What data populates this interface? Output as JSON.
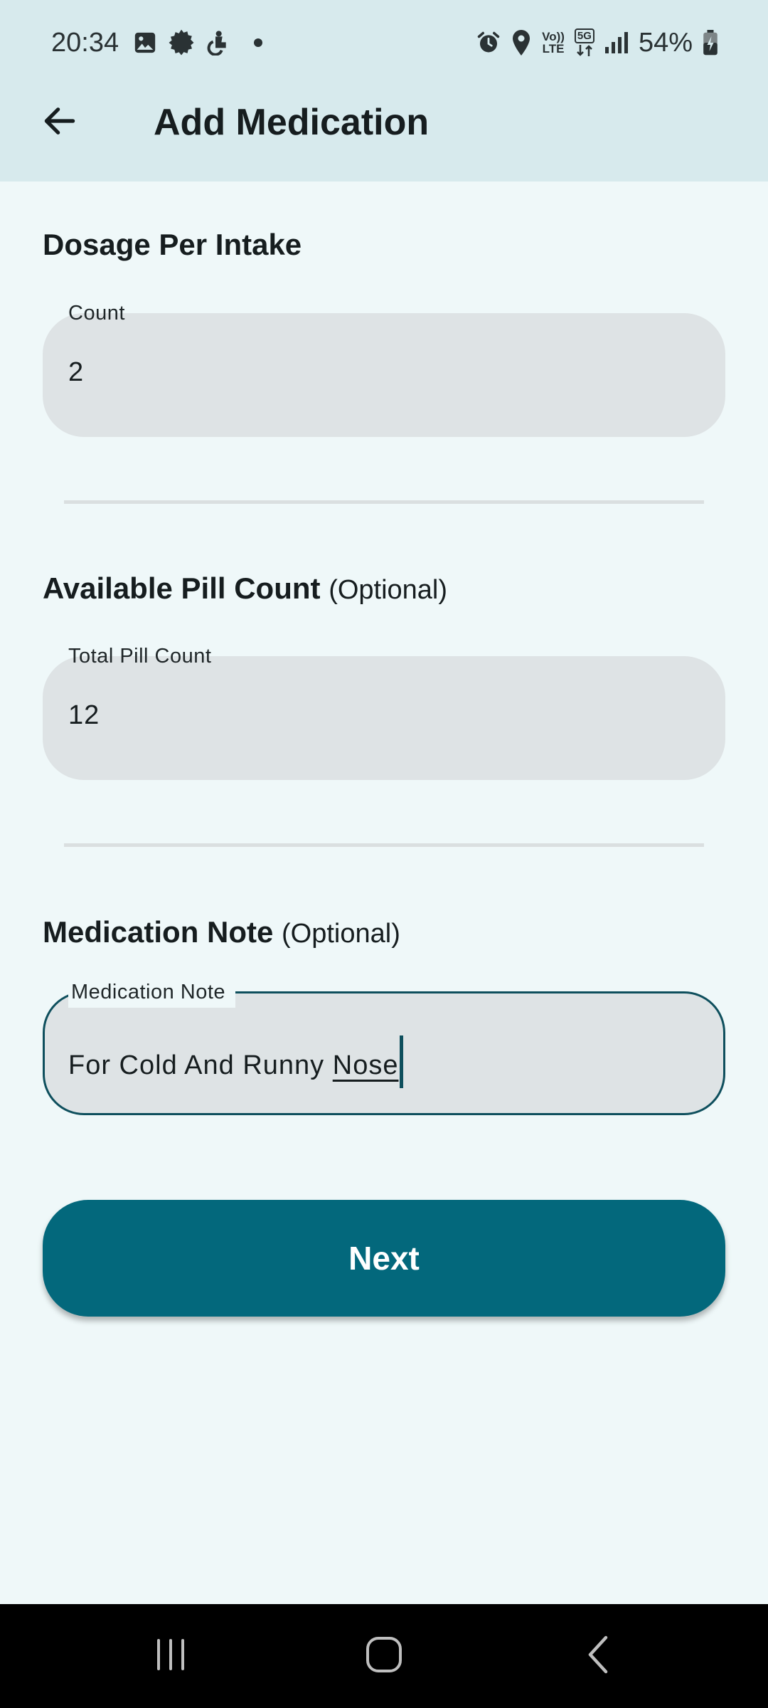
{
  "status_bar": {
    "time": "20:34",
    "left_icons": [
      "gallery-icon",
      "settings-gear-icon",
      "accessibility-icon",
      "notification-dot"
    ],
    "right_icons": [
      "alarm-icon",
      "location-icon",
      "volte-icon",
      "5g-data-icon",
      "signal-icon"
    ],
    "volte_top": "Vo))",
    "volte_bottom": "LTE",
    "net_label": "5G",
    "battery_percent": "54%"
  },
  "app_bar": {
    "back_icon": "arrow-back-icon",
    "title": "Add Medication"
  },
  "dosage_section": {
    "heading": "Dosage Per Intake",
    "field_label": "Count",
    "field_value": "2"
  },
  "pill_section": {
    "heading": "Available Pill Count",
    "heading_suffix": "(Optional)",
    "field_label": "Total Pill Count",
    "field_value": "12"
  },
  "note_section": {
    "heading": "Medication Note",
    "heading_suffix": "(Optional)",
    "field_label": "Medication Note",
    "field_value_prefix": "For Cold And Runny ",
    "field_value_underlined": "Nose"
  },
  "next_button": {
    "label": "Next"
  },
  "nav_bar": {
    "recents_icon": "recents-icon",
    "home_icon": "home-icon",
    "back_icon": "nav-back-icon"
  },
  "colors": {
    "primary": "#03687c",
    "app_bar_bg": "#d7eaed",
    "background": "#eff8f9",
    "field_bg": "#dee3e5",
    "focus_border": "#0e4f5d"
  }
}
